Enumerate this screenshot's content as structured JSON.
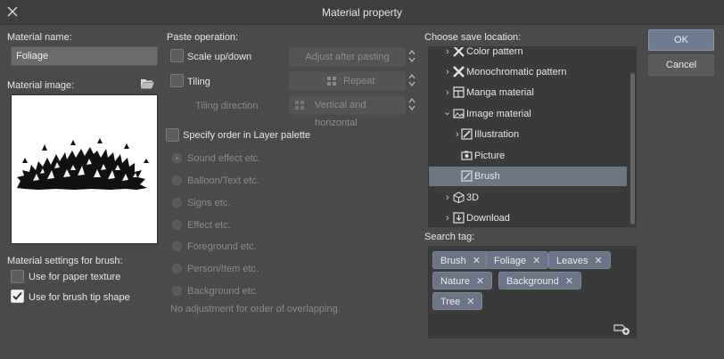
{
  "window": {
    "title": "Material property",
    "close_icon": "close-icon"
  },
  "left": {
    "material_name_label": "Material name:",
    "material_name_value": "Foliage",
    "material_image_label": "Material image:",
    "open_folder_icon": "folder-open-icon",
    "brush_settings_label": "Material settings for brush:",
    "paper_texture": {
      "label": "Use for paper texture",
      "checked": false
    },
    "brush_tip": {
      "label": "Use for brush tip shape",
      "checked": true
    }
  },
  "paste": {
    "label": "Paste operation:",
    "scale": {
      "label": "Scale up/down",
      "checked": false
    },
    "tiling": {
      "label": "Tiling",
      "checked": false
    },
    "adjust_after_pasting": "Adjust after pasting",
    "repeat": "Repeat",
    "tiling_direction_label": "Tiling direction",
    "tiling_direction_value": "Vertical and horizontal",
    "specify_order": {
      "label": "Specify order in Layer palette",
      "checked": false
    },
    "layer_options": [
      "Sound effect etc.",
      "Balloon/Text etc.",
      "Signs etc.",
      "Effect etc.",
      "Foreground etc.",
      "Person/Item etc.",
      "Background etc."
    ],
    "selected_layer_option": "Sound effect etc.",
    "no_adjustment_note": "No adjustment for order of overlapping."
  },
  "save_location": {
    "label": "Choose save location:",
    "items": [
      {
        "label": "Color pattern",
        "icon": "color-pattern-icon",
        "level": 1,
        "expanded": false,
        "selected": false
      },
      {
        "label": "Monochromatic pattern",
        "icon": "monochromatic-pattern-icon",
        "level": 1,
        "expanded": false,
        "selected": false
      },
      {
        "label": "Manga material",
        "icon": "manga-material-icon",
        "level": 1,
        "expanded": false,
        "selected": false
      },
      {
        "label": "Image material",
        "icon": "image-material-icon",
        "level": 1,
        "expanded": true,
        "selected": false
      },
      {
        "label": "Illustration",
        "icon": "illustration-icon",
        "level": 2,
        "expanded": false,
        "selected": false
      },
      {
        "label": "Picture",
        "icon": "camera-icon",
        "level": 2,
        "expanded": null,
        "selected": false
      },
      {
        "label": "Brush",
        "icon": "brush-icon",
        "level": 2,
        "expanded": null,
        "selected": true
      },
      {
        "label": "3D",
        "icon": "cube-icon",
        "level": 1,
        "expanded": false,
        "selected": false
      },
      {
        "label": "Download",
        "icon": "download-icon",
        "level": 1,
        "expanded": false,
        "selected": false
      }
    ]
  },
  "search_tag": {
    "label": "Search tag:",
    "tags": [
      "Brush",
      "Foliage",
      "Leaves",
      "Nature",
      "Background",
      "Tree"
    ],
    "add_tag_icon": "add-tag-icon"
  },
  "buttons": {
    "ok": "OK",
    "cancel": "Cancel"
  },
  "colors": {
    "accent": "#6e7c93",
    "selection": "#6e7685",
    "tag": "#6b7587",
    "background": "#4a4a4a"
  }
}
